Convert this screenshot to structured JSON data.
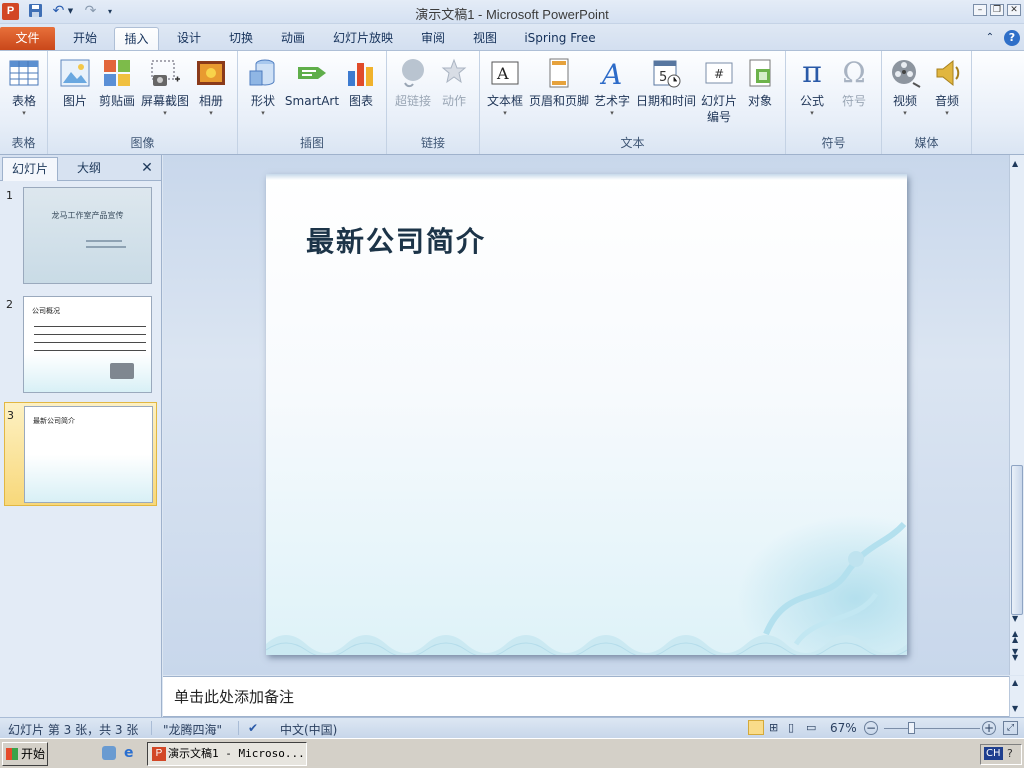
{
  "window": {
    "title": "演示文稿1  -  Microsoft PowerPoint"
  },
  "tabs": [
    "文件",
    "开始",
    "插入",
    "设计",
    "切换",
    "动画",
    "幻灯片放映",
    "审阅",
    "视图",
    "iSpring Free"
  ],
  "active_tab": "插入",
  "ribbon": {
    "groups": {
      "table": "表格",
      "images": "图像",
      "illustrations": "插图",
      "links": "链接",
      "text": "文本",
      "symbols": "符号",
      "media": "媒体"
    },
    "buttons": {
      "table": "表格",
      "picture": "图片",
      "clipart": "剪贴画",
      "screenshot": "屏幕截图",
      "album": "相册",
      "shapes": "形状",
      "smartart": "SmartArt",
      "chart": "图表",
      "hyperlink": "超链接",
      "action": "动作",
      "textbox": "文本框",
      "headerfooter": "页眉和页脚",
      "wordart": "艺术字",
      "datetime": "日期和时间",
      "slidenum_1": "幻灯片",
      "slidenum_2": "编号",
      "object": "对象",
      "equation": "公式",
      "symbol": "符号",
      "video": "视频",
      "audio": "音频"
    }
  },
  "pane": {
    "tab_slides": "幻灯片",
    "tab_outline": "大纲"
  },
  "thumbnails": [
    {
      "num": "1",
      "title": "龙马工作室产品宣传"
    },
    {
      "num": "2",
      "title": "公司概况"
    },
    {
      "num": "3",
      "title": "最新公司简介"
    }
  ],
  "slide": {
    "title": "最新公司简介"
  },
  "notes": {
    "placeholder": "单击此处添加备注"
  },
  "status": {
    "slide_info": "幻灯片 第 3 张，共 3 张",
    "theme": "\"龙腾四海\"",
    "language": "中文(中国)",
    "zoom": "67%"
  },
  "taskbar": {
    "start": "开始",
    "item": "演示文稿1 - Microso...",
    "ime": "CH"
  },
  "colors": {
    "file_tab": "#d55a2a",
    "ribbon_bg": "#e7eef8",
    "slide_bg": "#ffffff",
    "thumb_selected": "#f8d87a"
  }
}
